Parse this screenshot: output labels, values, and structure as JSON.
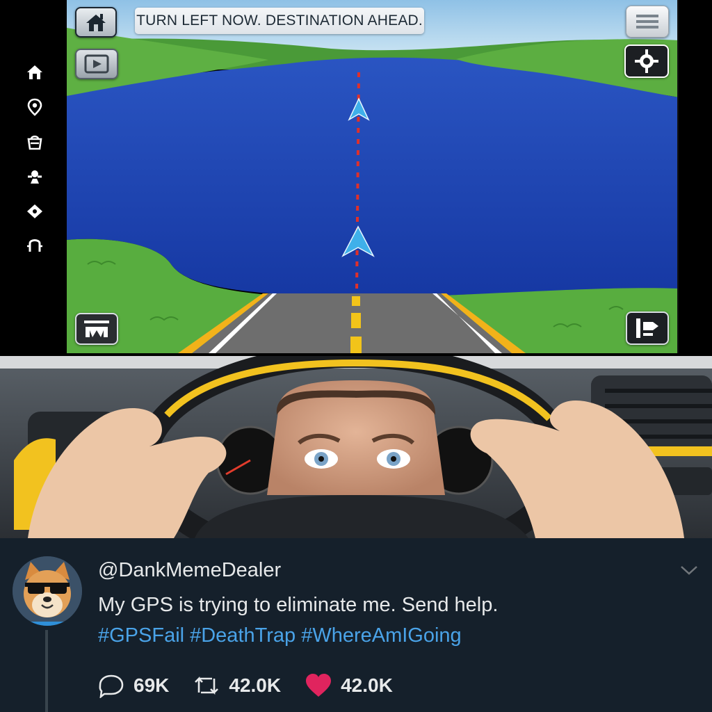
{
  "gps": {
    "instruction": "TURN LEFT NOW. DESTINATION AHEAD.",
    "rail_icons": [
      "home-icon",
      "location-pin-icon",
      "bag-icon",
      "settings-icon",
      "diamond-icon",
      "user-icon"
    ],
    "colors": {
      "water": "#1a3ea9",
      "land": "#4fa83a",
      "sky": "#8fc1e6",
      "route": "#e0302a",
      "road": "#6e6e6e",
      "road_edge": "#f2b21a"
    }
  },
  "tweet": {
    "handle": "@DankMemeDealer",
    "text": "My GPS is trying to eliminate me. Send help.",
    "hashtags": [
      "#GPSFail",
      "#DeathTrap",
      "#WhereAmIGoing"
    ],
    "replies": "69K",
    "retweets": "42.0K",
    "likes": "42.0K",
    "colors": {
      "background": "#15202b",
      "hashtag": "#4aa3e8",
      "like": "#e0245e"
    }
  }
}
